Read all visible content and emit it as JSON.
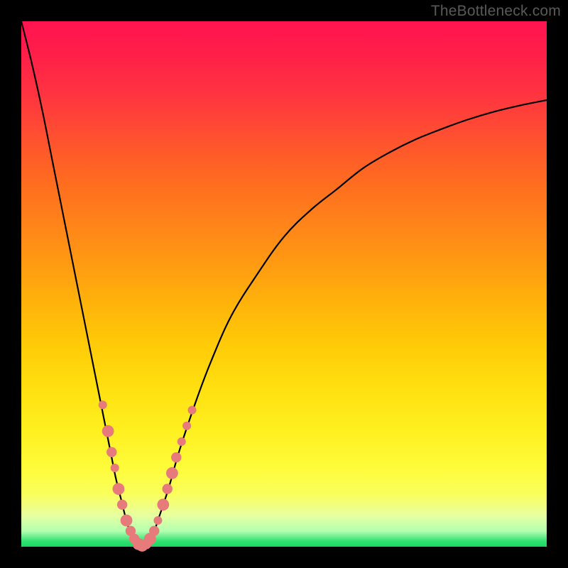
{
  "watermark": "TheBottleneck.com",
  "colors": {
    "curve_stroke": "#000000",
    "dot_fill": "#e77a7a",
    "dot_stroke": "#d66565"
  },
  "chart_data": {
    "type": "line",
    "title": "",
    "xlabel": "",
    "ylabel": "",
    "xlim": [
      0,
      100
    ],
    "ylim": [
      0,
      100
    ],
    "series": [
      {
        "name": "bottleneck-curve",
        "x": [
          0,
          2,
          4,
          6,
          8,
          10,
          12,
          14,
          16,
          17,
          18,
          19,
          20,
          21,
          22,
          23,
          24,
          25,
          26,
          28,
          30,
          33,
          36,
          40,
          45,
          50,
          55,
          60,
          65,
          70,
          75,
          80,
          85,
          90,
          95,
          100
        ],
        "y": [
          100,
          92,
          83,
          73,
          63,
          53,
          43,
          33,
          23,
          18,
          13,
          9,
          5,
          2,
          0.5,
          0,
          0.5,
          2,
          5,
          11,
          18,
          27,
          35,
          44,
          52,
          59,
          64,
          68,
          72,
          75,
          77.5,
          79.5,
          81.3,
          82.8,
          84,
          85
        ]
      }
    ],
    "markers": [
      {
        "x": 15.5,
        "y": 27,
        "r": 1.0
      },
      {
        "x": 16.5,
        "y": 22,
        "r": 1.4
      },
      {
        "x": 17.2,
        "y": 18,
        "r": 1.2
      },
      {
        "x": 17.8,
        "y": 15,
        "r": 1.0
      },
      {
        "x": 18.5,
        "y": 11,
        "r": 1.4
      },
      {
        "x": 19.2,
        "y": 8,
        "r": 1.2
      },
      {
        "x": 20.0,
        "y": 5,
        "r": 1.4
      },
      {
        "x": 20.8,
        "y": 3,
        "r": 1.2
      },
      {
        "x": 21.5,
        "y": 1.5,
        "r": 1.2
      },
      {
        "x": 22.3,
        "y": 0.5,
        "r": 1.4
      },
      {
        "x": 23.0,
        "y": 0.2,
        "r": 1.4
      },
      {
        "x": 23.8,
        "y": 0.5,
        "r": 1.2
      },
      {
        "x": 24.5,
        "y": 1.5,
        "r": 1.4
      },
      {
        "x": 25.3,
        "y": 3,
        "r": 1.2
      },
      {
        "x": 26.0,
        "y": 5,
        "r": 1.0
      },
      {
        "x": 27.0,
        "y": 8,
        "r": 1.4
      },
      {
        "x": 27.8,
        "y": 11,
        "r": 1.2
      },
      {
        "x": 28.7,
        "y": 14,
        "r": 1.4
      },
      {
        "x": 29.5,
        "y": 17,
        "r": 1.2
      },
      {
        "x": 30.5,
        "y": 20,
        "r": 1.0
      },
      {
        "x": 31.5,
        "y": 23,
        "r": 1.0
      },
      {
        "x": 32.5,
        "y": 26,
        "r": 1.0
      }
    ]
  }
}
